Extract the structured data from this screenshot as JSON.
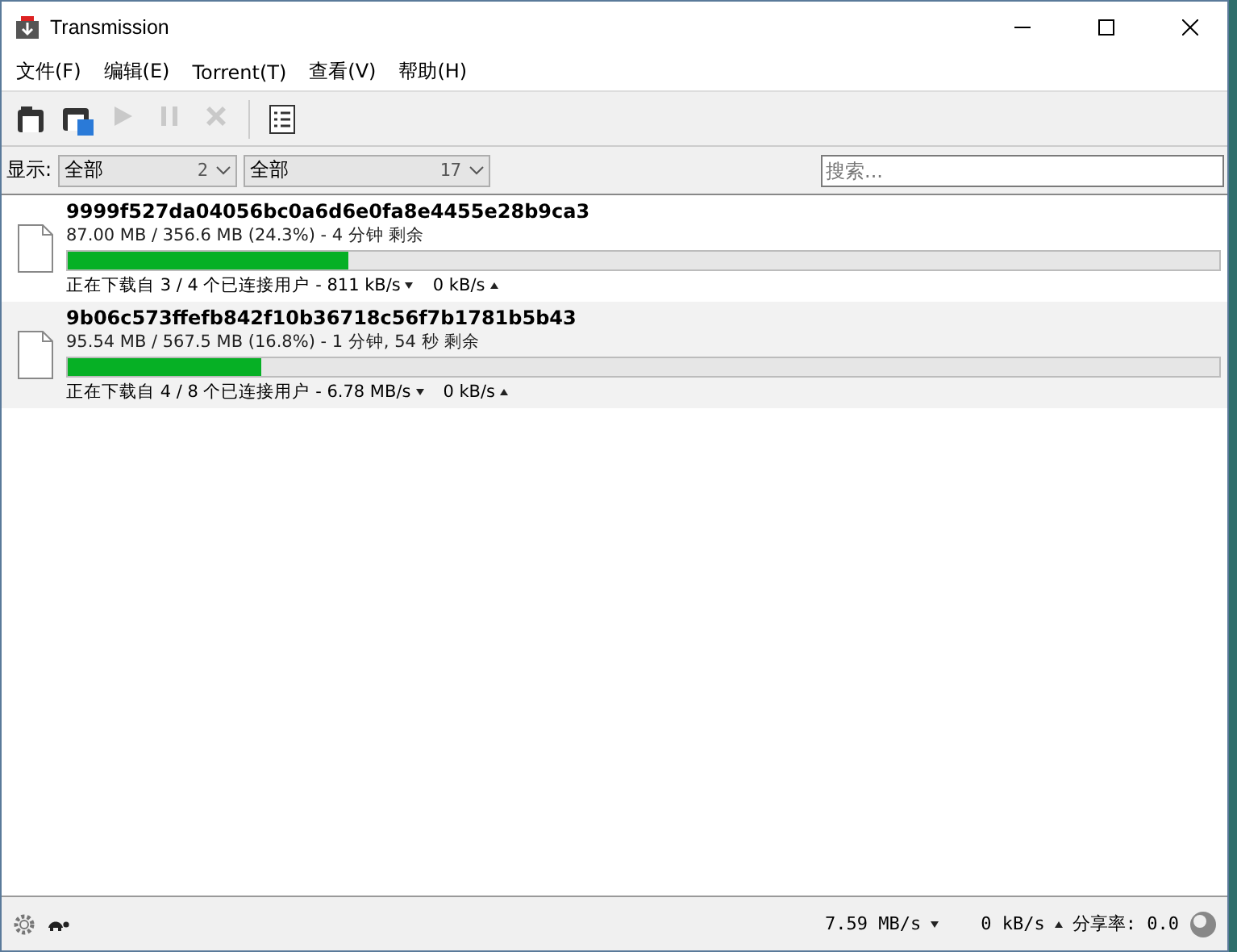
{
  "window": {
    "title": "Transmission"
  },
  "menu": [
    "文件(F)",
    "编辑(E)",
    "Torrent(T)",
    "查看(V)",
    "帮助(H)"
  ],
  "toolbar": [
    {
      "kind": "open",
      "disabled": false
    },
    {
      "kind": "open-url",
      "disabled": false
    },
    {
      "kind": "start",
      "disabled": true
    },
    {
      "kind": "pause",
      "disabled": true
    },
    {
      "kind": "remove",
      "disabled": true
    },
    {
      "kind": "separator"
    },
    {
      "kind": "properties",
      "disabled": false
    }
  ],
  "filter": {
    "label": "显示:",
    "dropdowns": [
      {
        "value": "全部",
        "count": "2"
      },
      {
        "value": "全部",
        "count": "17"
      }
    ],
    "search": {
      "placeholder": "搜索..."
    }
  },
  "torrents": [
    {
      "name": "9999f527da04056bc0a6d6e0fa8e4455e28b9ca3",
      "progress": "87.00 MB / 356.6 MB (24.3%) - 4 分钟 剩余",
      "level": 0.243,
      "status": "正在下载自 3 / 4 个已连接用户 - 811 kB/s",
      "upload": "0 kB/s"
    },
    {
      "name": "9b06c573ffefb842f10b36718c56f7b1781b5b43",
      "progress": "95.54 MB / 567.5 MB (16.8%) - 1 分钟, 54 秒 剩余",
      "level": 0.168,
      "status": "正在下载自 4 / 8 个已连接用户 - 6.78 MB/s",
      "upload": "0 kB/s"
    }
  ],
  "status_bar": {
    "download": "7.59 MB/s",
    "upload": "0 kB/s",
    "ratio": "分享率: 0.0"
  }
}
